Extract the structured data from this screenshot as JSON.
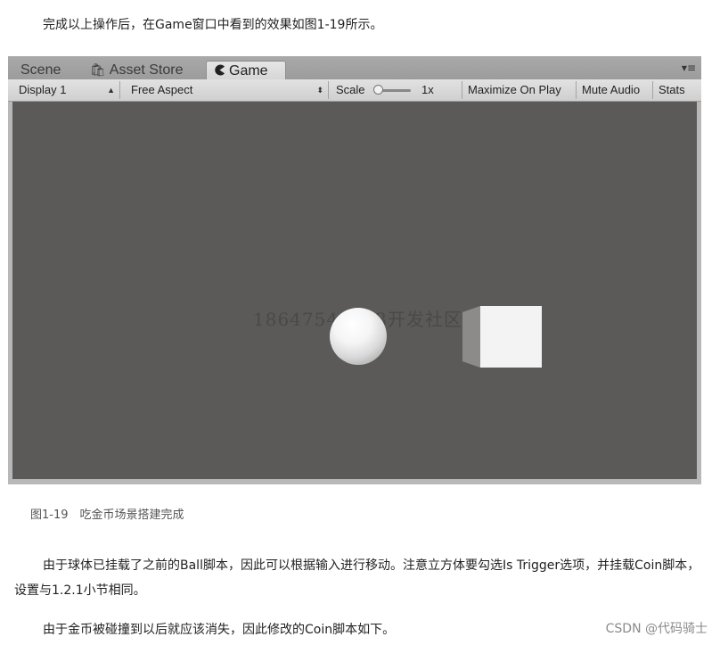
{
  "intro_text": "完成以上操作后，在Game窗口中看到的效果如图1-19所示。",
  "unity_window": {
    "tabs": [
      {
        "label": "Scene"
      },
      {
        "label": "Asset Store",
        "icon": "store-bag-icon"
      },
      {
        "label": "Game",
        "icon": "pacman-game-icon"
      }
    ],
    "tab_menu_glyph": "▾≡",
    "toolbar": {
      "display_label": "Display 1",
      "aspect_label": "Free Aspect",
      "scale_label": "Scale",
      "scale_value": "1x",
      "maximize_label": "Maximize On Play",
      "mute_label": "Mute Audio",
      "stats_label": "Stats"
    },
    "viewport": {
      "watermark": "18647546863开发社区",
      "objects": [
        "sphere",
        "cube"
      ]
    }
  },
  "caption": "图1-19　吃金币场景搭建完成",
  "paragraph_2": "由于球体已挂载了之前的Ball脚本，因此可以根据输入进行移动。注意立方体要勾选Is Trigger选项，并挂载Coin脚本，设置与1.2.1小节相同。",
  "paragraph_3": "由于金币被碰撞到以后就应该消失，因此修改的Coin脚本如下。",
  "csdn_watermark": "CSDN @代码骑士",
  "colors": {
    "viewport_bg": "#5c5a58",
    "toolbar_bg": "#d8d8d8",
    "tabbar_bg": "#a3a3a3"
  }
}
